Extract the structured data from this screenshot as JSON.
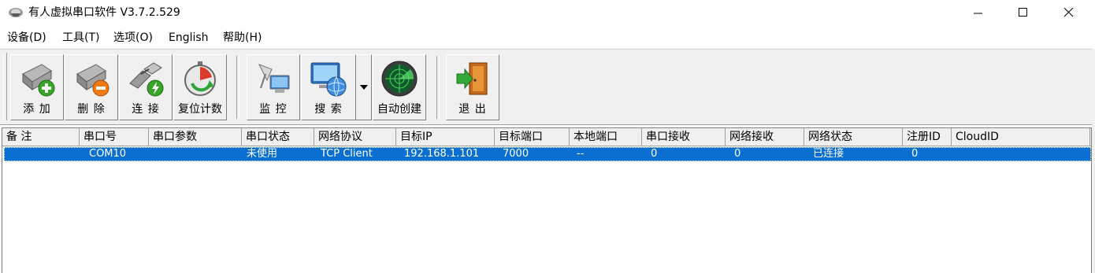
{
  "window": {
    "title": "有人虚拟串口软件 V3.7.2.529"
  },
  "menu": [
    {
      "label": "设备(D)"
    },
    {
      "label": "工具(T)"
    },
    {
      "label": "选项(O)"
    },
    {
      "label": "English"
    },
    {
      "label": "帮助(H)"
    }
  ],
  "toolbar": {
    "add": "添 加",
    "delete": "删 除",
    "connect": "连 接",
    "reset_count": "复位计数",
    "monitor": "监 控",
    "search": "搜 索",
    "auto_create": "自动创建",
    "exit": "退 出"
  },
  "table": {
    "columns": [
      "备 注",
      "串口号",
      "串口参数",
      "串口状态",
      "网络协议",
      "目标IP",
      "目标端口",
      "本地端口",
      "串口接收",
      "网络接收",
      "网络状态",
      "注册ID",
      "CloudID"
    ],
    "rows": [
      {
        "note": "",
        "port": "COM10",
        "params": "",
        "port_status": "未使用",
        "protocol": "TCP Client",
        "target_ip": "192.168.1.101",
        "target_port": "7000",
        "local_port": "--",
        "serial_rx": "0",
        "net_rx": "0",
        "net_status": "已连接",
        "reg_id": "0",
        "cloud_id": ""
      }
    ]
  },
  "colors": {
    "selection": "#0a6fd0",
    "toolbar_bg": "#f0f0f0"
  }
}
